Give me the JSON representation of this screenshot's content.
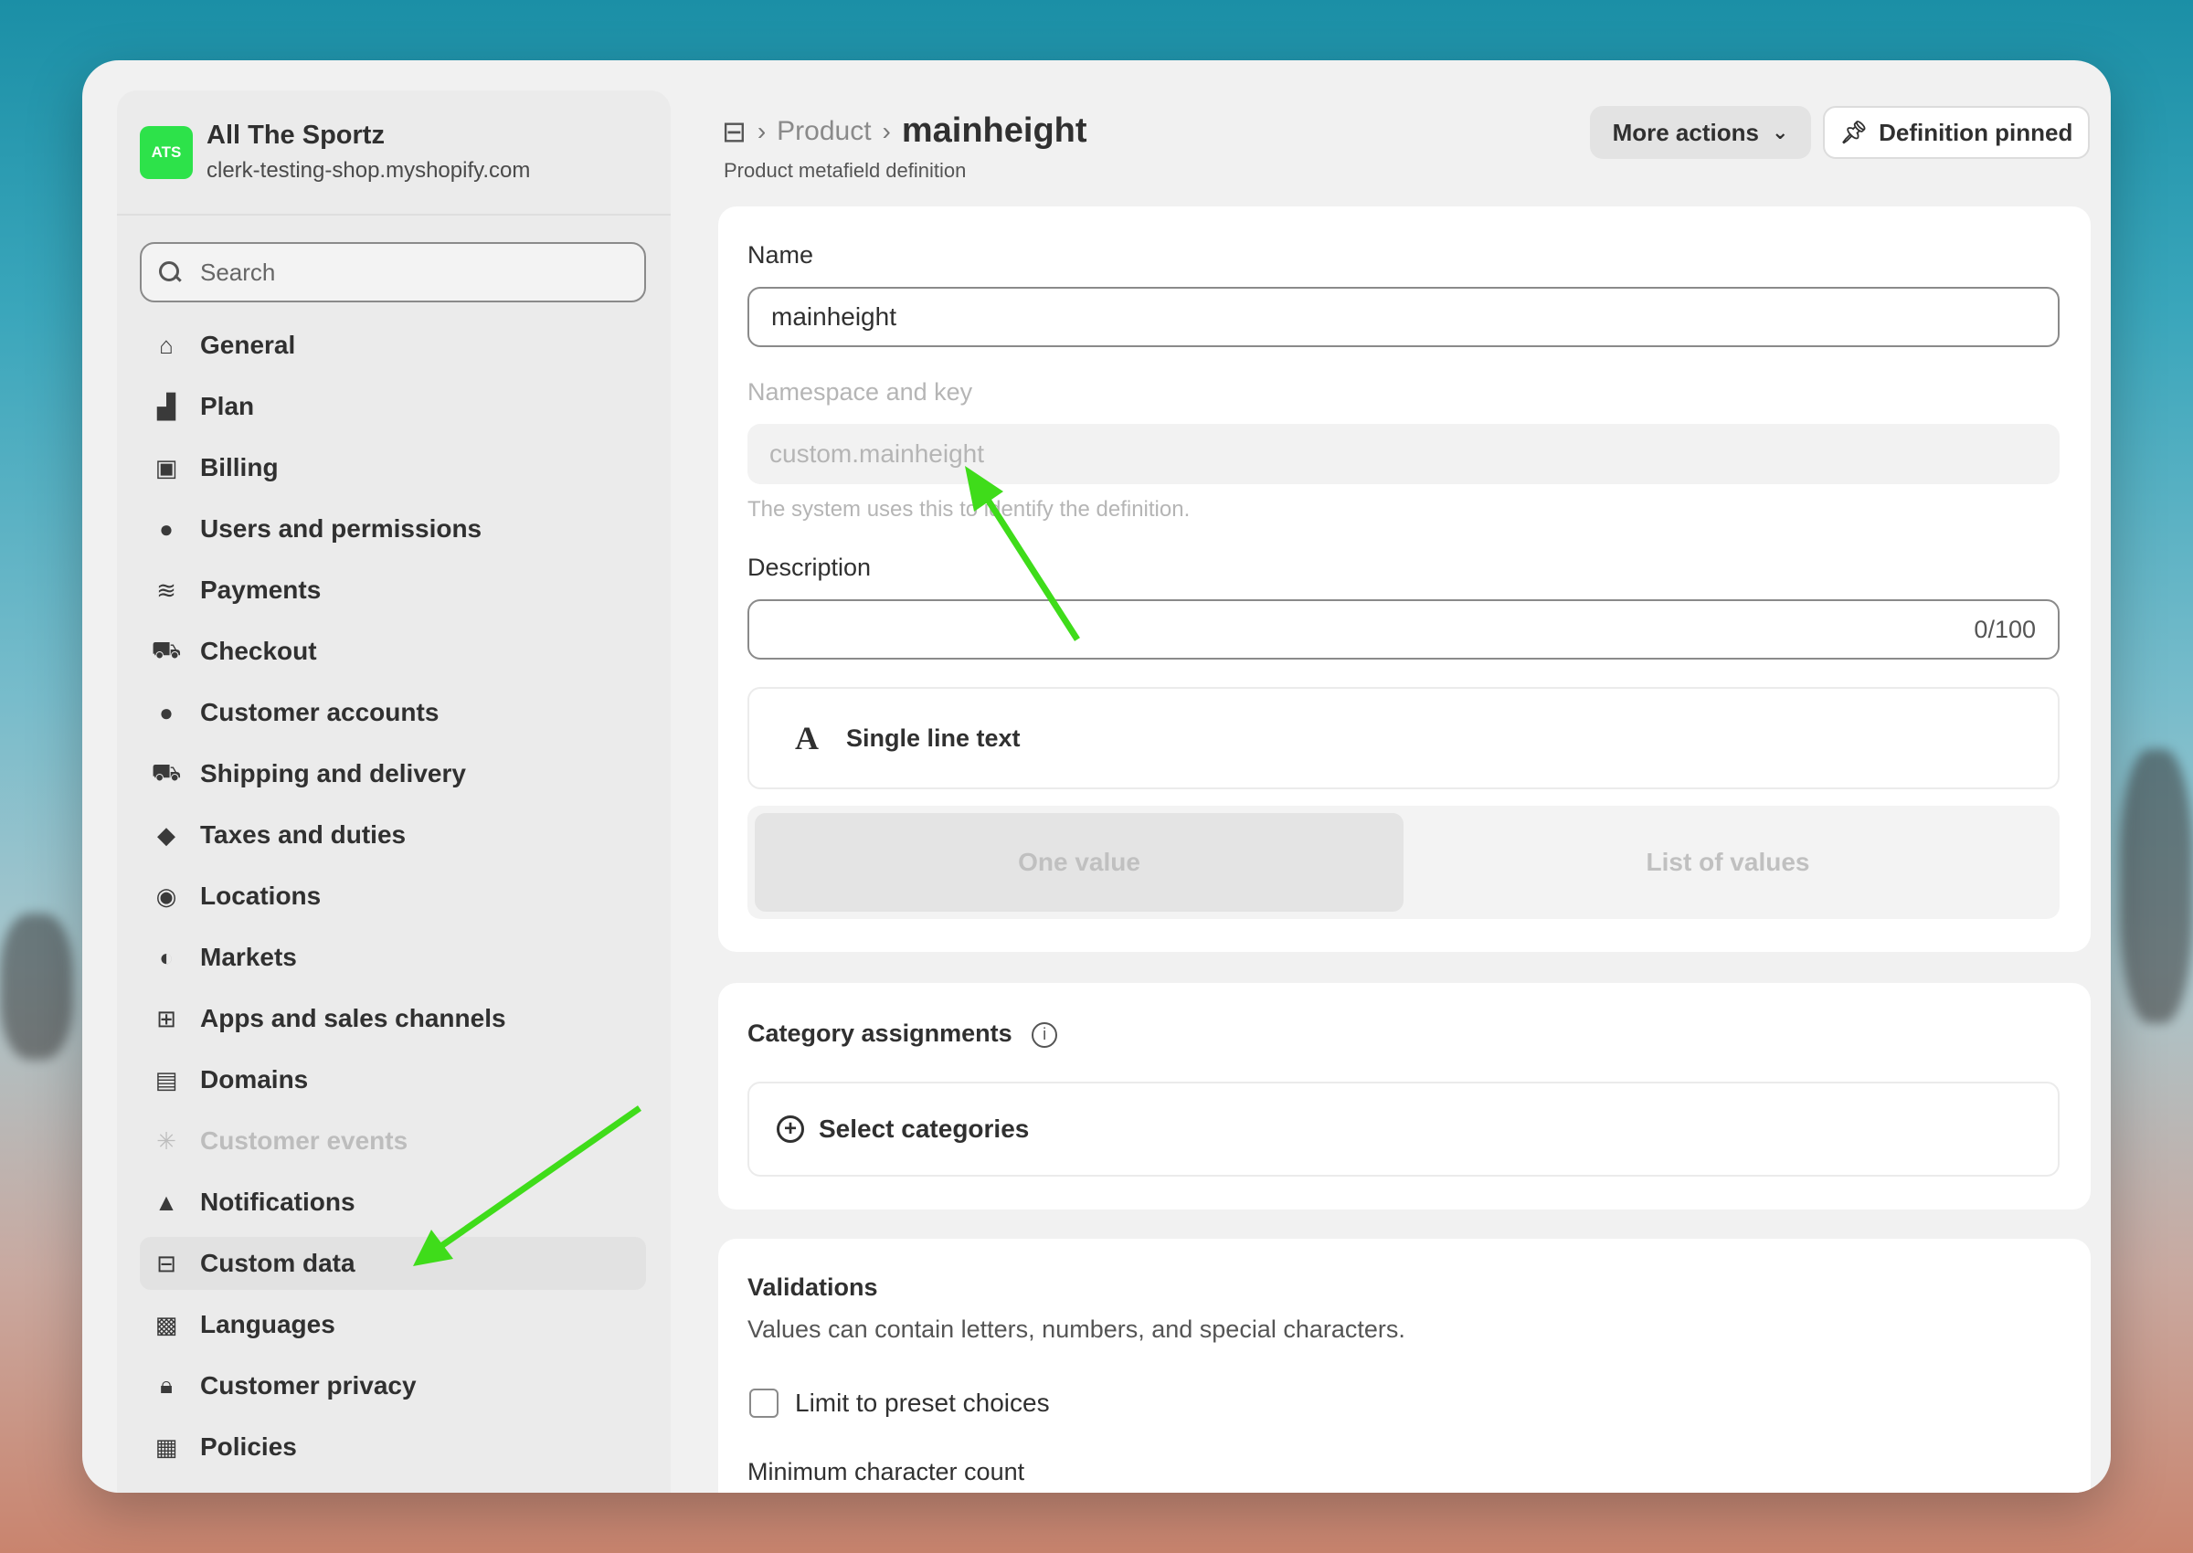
{
  "store": {
    "logo_text": "ATS",
    "name": "All The Sportz",
    "url": "clerk-testing-shop.myshopify.com"
  },
  "search": {
    "placeholder": "Search"
  },
  "sidebar": {
    "items": [
      {
        "label": "General",
        "icon": "store-icon"
      },
      {
        "label": "Plan",
        "icon": "plan-icon"
      },
      {
        "label": "Billing",
        "icon": "billing-icon"
      },
      {
        "label": "Users and permissions",
        "icon": "users-icon"
      },
      {
        "label": "Payments",
        "icon": "payments-icon"
      },
      {
        "label": "Checkout",
        "icon": "cart-icon"
      },
      {
        "label": "Customer accounts",
        "icon": "person-icon"
      },
      {
        "label": "Shipping and delivery",
        "icon": "truck-icon"
      },
      {
        "label": "Taxes and duties",
        "icon": "tax-icon"
      },
      {
        "label": "Locations",
        "icon": "location-icon"
      },
      {
        "label": "Markets",
        "icon": "globe-icon"
      },
      {
        "label": "Apps and sales channels",
        "icon": "apps-icon"
      },
      {
        "label": "Domains",
        "icon": "domains-icon"
      },
      {
        "label": "Customer events",
        "icon": "cursor-icon"
      },
      {
        "label": "Notifications",
        "icon": "bell-icon"
      },
      {
        "label": "Custom data",
        "icon": "custom-data-icon"
      },
      {
        "label": "Languages",
        "icon": "languages-icon"
      },
      {
        "label": "Customer privacy",
        "icon": "lock-icon"
      },
      {
        "label": "Policies",
        "icon": "policies-icon"
      }
    ]
  },
  "header": {
    "crumb_product": "Product",
    "title": "mainheight",
    "subtitle": "Product metafield definition",
    "more_actions": "More actions",
    "pinned": "Definition pinned"
  },
  "definition": {
    "name_label": "Name",
    "name_value": "mainheight",
    "namespace_label": "Namespace and key",
    "namespace_value": "custom.mainheight",
    "namespace_help": "The system uses this to identify the definition.",
    "description_label": "Description",
    "description_counter": "0/100",
    "type_label": "Single line text",
    "type_glyph": "A",
    "one_value": "One value",
    "list_values": "List of values"
  },
  "categories": {
    "title": "Category assignments",
    "select": "Select categories"
  },
  "validations": {
    "title": "Validations",
    "description": "Values can contain letters, numbers, and special characters.",
    "limit_label": "Limit to preset choices",
    "min_label": "Minimum character count"
  },
  "colors": {
    "annotation_arrow": "#3fdc1a",
    "logo": "#2de24a"
  }
}
